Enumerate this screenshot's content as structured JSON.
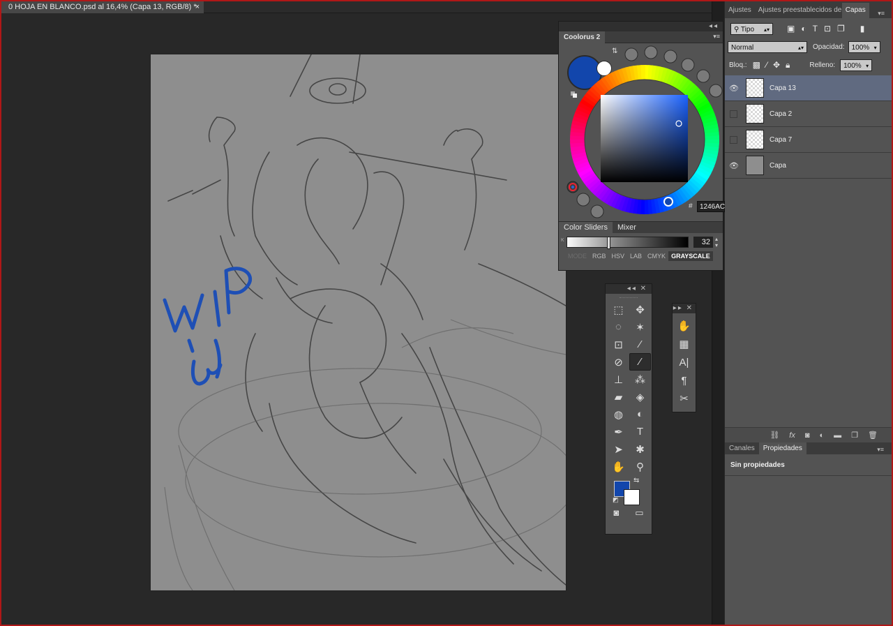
{
  "document": {
    "tab_title": "0 HOJA EN BLANCO.psd al 16,4% (Capa 13, RGB/8) *",
    "close": "×"
  },
  "colors": {
    "foreground": "#1246ac",
    "background": "#ffffff",
    "accent_selection": "#606a80"
  },
  "canvas": {
    "wip_text": "WIP",
    "smiley_text": ":3"
  },
  "coolorus": {
    "title": "Coolorus 2",
    "hex_label": "#",
    "hex_value": "1246AC",
    "tabs": [
      "Color Sliders",
      "Mixer"
    ],
    "slider_channel": "K",
    "slider_value": "32",
    "modes": [
      "MODE",
      "RGB",
      "HSV",
      "LAB",
      "CMYK",
      "GRAYSCALE"
    ],
    "active_mode": "GRAYSCALE"
  },
  "tools": {
    "items": [
      {
        "name": "rectangular-marquee-tool",
        "glyph": "⬚"
      },
      {
        "name": "move-tool",
        "glyph": "✥"
      },
      {
        "name": "lasso-tool",
        "glyph": "◌"
      },
      {
        "name": "magic-wand-tool",
        "glyph": "✶"
      },
      {
        "name": "crop-tool",
        "glyph": "⊡"
      },
      {
        "name": "eyedropper-tool",
        "glyph": "⁄"
      },
      {
        "name": "spot-healing-tool",
        "glyph": "⊘"
      },
      {
        "name": "brush-tool",
        "glyph": "⁄"
      },
      {
        "name": "clone-stamp-tool",
        "glyph": "⊥"
      },
      {
        "name": "history-brush-tool",
        "glyph": "⁂"
      },
      {
        "name": "eraser-tool",
        "glyph": "▰"
      },
      {
        "name": "paint-bucket-tool",
        "glyph": "◈"
      },
      {
        "name": "blur-tool",
        "glyph": "◍"
      },
      {
        "name": "dodge-tool",
        "glyph": "◐"
      },
      {
        "name": "pen-tool",
        "glyph": "✒"
      },
      {
        "name": "type-tool",
        "glyph": "T"
      },
      {
        "name": "path-selection-tool",
        "glyph": "➤"
      },
      {
        "name": "custom-shape-tool",
        "glyph": "✱"
      },
      {
        "name": "hand-tool",
        "glyph": "✋"
      },
      {
        "name": "zoom-tool",
        "glyph": "⚲"
      }
    ],
    "quick_mask_glyph": "◙",
    "screen_mode_glyph": "▭"
  },
  "mini_panel": {
    "items": [
      "✋",
      "▦",
      "A|",
      "¶",
      "✂"
    ]
  },
  "dock": {
    "tabs": [
      "Ajustes",
      "Ajustes preestablecidos de p",
      "Capas"
    ],
    "active_tab": "Capas",
    "filter_label": "Tipo",
    "blend_mode": "Normal",
    "opacity_label": "Opacidad:",
    "opacity_value": "100%",
    "lock_label": "Bloq.:",
    "fill_label": "Relleno:",
    "fill_value": "100%",
    "layers": [
      {
        "name": "Capa 13",
        "visible": true,
        "selected": true
      },
      {
        "name": "Capa 2",
        "visible": false,
        "selected": false
      },
      {
        "name": "Capa 7",
        "visible": false,
        "selected": false
      },
      {
        "name": "Capa",
        "visible": true,
        "selected": false
      }
    ],
    "bottom_icons": [
      "link-icon",
      "fx-icon",
      "mask-icon",
      "adjustment-icon",
      "folder-icon",
      "new-layer-icon",
      "trash-icon"
    ],
    "prop_tabs": [
      "Canales",
      "Propiedades"
    ],
    "no_properties": "Sin propiedades"
  }
}
